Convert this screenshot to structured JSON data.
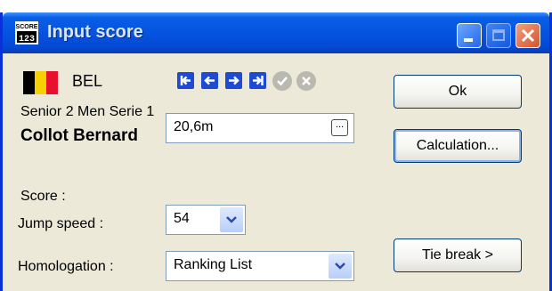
{
  "window": {
    "title": "Input score",
    "icon": "score-app-icon",
    "colors": {
      "titlebar": "#0454e0",
      "face": "#ece9d8",
      "nav_button": "#1e4bd2"
    }
  },
  "athlete": {
    "country_code": "BEL",
    "flag_colors": [
      "#000000",
      "#f6d000",
      "#e8112d"
    ],
    "category": "Senior 2 Men Serie 1",
    "name": "Collot Bernard"
  },
  "nav_icons": [
    "first-record-icon",
    "previous-record-icon",
    "next-record-icon",
    "last-record-icon",
    "confirm-icon",
    "cancel-icon"
  ],
  "form": {
    "score_label": "Score :",
    "score_value": "20,6m",
    "score_ellipsis": "...",
    "jump_speed_label": "Jump speed :",
    "jump_speed_value": "54",
    "homologation_label": "Homologation :",
    "homologation_value": "Ranking List"
  },
  "buttons": {
    "ok": "Ok",
    "calculation": "Calculation...",
    "tie_break": "Tie break >"
  }
}
